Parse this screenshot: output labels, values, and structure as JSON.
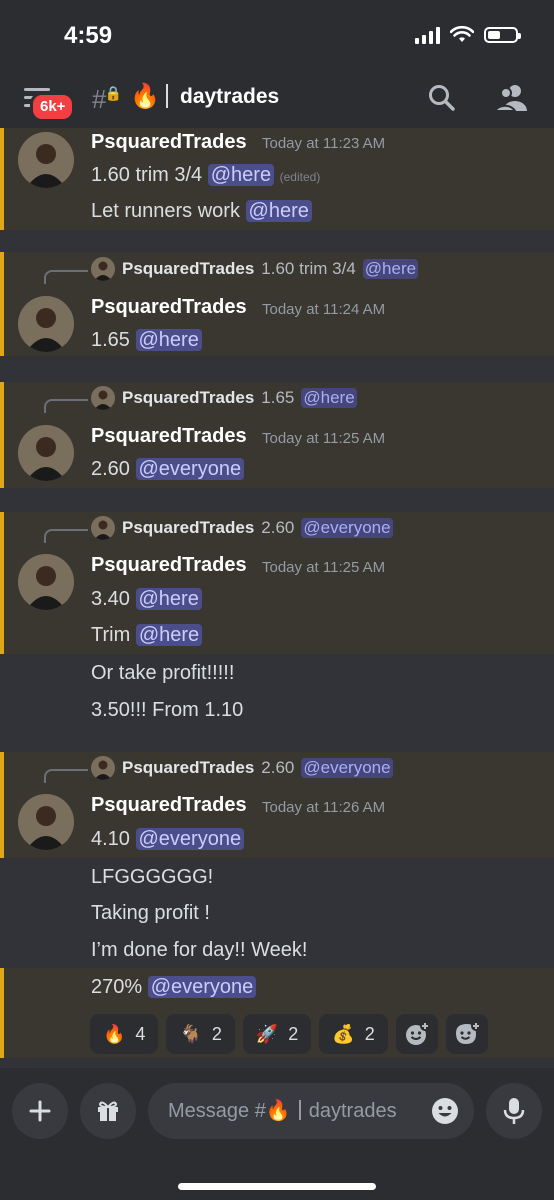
{
  "status_bar": {
    "time": "4:59"
  },
  "header": {
    "badge": "6k+",
    "channel_emoji": "🔥",
    "channel_name": "daytrades"
  },
  "messages": [
    {
      "author": "PsquaredTrades",
      "timestamp": "Today at 11:23 AM",
      "line1": "1.60 trim 3/4",
      "mention1": "@here",
      "edited": "(edited)",
      "line2": "Let runners work",
      "mention2": "@here"
    },
    {
      "reply": {
        "author": "PsquaredTrades",
        "text": "1.60 trim 3/4",
        "mention": "@here"
      },
      "author": "PsquaredTrades",
      "timestamp": "Today at 11:24 AM",
      "line1": "1.65",
      "mention1": "@here"
    },
    {
      "reply": {
        "author": "PsquaredTrades",
        "text": "1.65",
        "mention": "@here"
      },
      "author": "PsquaredTrades",
      "timestamp": "Today at 11:25 AM",
      "line1": "2.60",
      "mention1": "@everyone"
    },
    {
      "reply": {
        "author": "PsquaredTrades",
        "text": "2.60",
        "mention": "@everyone"
      },
      "author": "PsquaredTrades",
      "timestamp": "Today at 11:25 AM",
      "line1": "3.40",
      "mention1": "@here",
      "line2": "Trim",
      "mention2": "@here",
      "line3": "Or take profit!!!!!",
      "line4": "3.50!!! From 1.10"
    },
    {
      "reply": {
        "author": "PsquaredTrades",
        "text": "2.60",
        "mention": "@everyone"
      },
      "author": "PsquaredTrades",
      "timestamp": "Today at 11:26 AM",
      "line1": "4.10",
      "mention1": "@everyone",
      "line2": "LFGGGGGG!",
      "line3": "Taking profit !",
      "line4": "I’m done for day!! Week!",
      "line5": "270%",
      "mention5": "@everyone"
    }
  ],
  "reactions": [
    {
      "emoji": "🔥",
      "count": "4"
    },
    {
      "emoji": "🐐",
      "count": "2"
    },
    {
      "emoji": "🚀",
      "count": "2"
    },
    {
      "emoji": "💰",
      "count": "2"
    }
  ],
  "composer": {
    "placeholder_prefix": "Message #",
    "placeholder_emoji": "🔥",
    "placeholder_suffix": "daytrades"
  },
  "colors": {
    "highlight": "#3a3630",
    "highlight_bar": "#e0a818",
    "mention_bg": "#4b4e8a",
    "badge": "#f23f43"
  },
  "icons": [
    "menu-icon",
    "hash-lock-icon",
    "search-icon",
    "members-icon",
    "add-icon",
    "gift-icon",
    "emoji-icon",
    "microphone-icon",
    "add-reaction-icon",
    "add-super-reaction-icon"
  ]
}
